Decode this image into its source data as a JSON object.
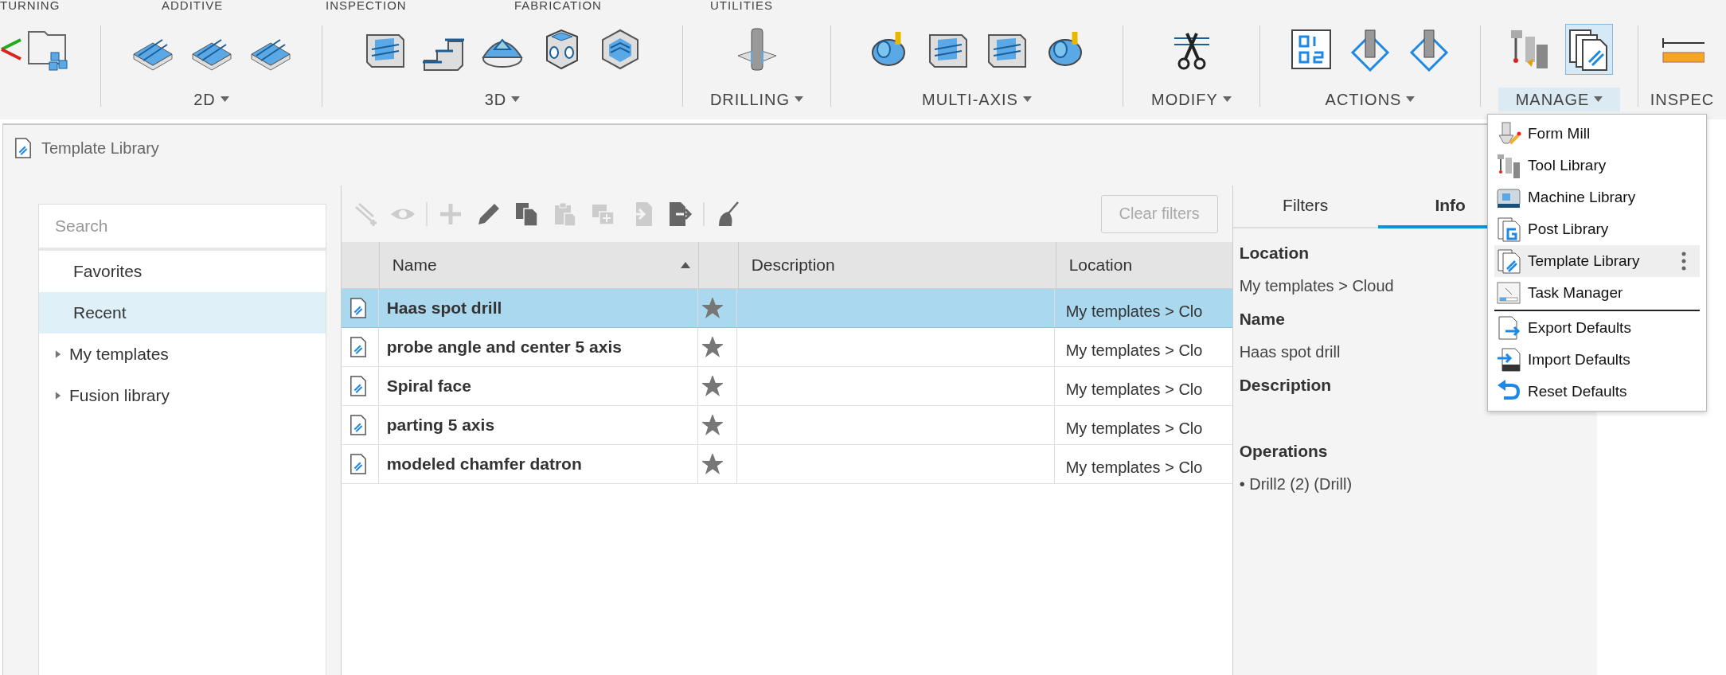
{
  "ribbon": {
    "categories": [
      "TURNING",
      "ADDITIVE",
      "INSPECTION",
      "FABRICATION",
      "UTILITIES"
    ],
    "groups": [
      {
        "label": "2D",
        "expanded": false
      },
      {
        "label": "3D",
        "expanded": false
      },
      {
        "label": "DRILLING",
        "expanded": false
      },
      {
        "label": "MULTI-AXIS",
        "expanded": false
      },
      {
        "label": "MODIFY",
        "expanded": false
      },
      {
        "label": "ACTIONS",
        "expanded": false
      },
      {
        "label": "MANAGE",
        "expanded": true
      },
      {
        "label": "INSPEC"
      }
    ]
  },
  "dialog": {
    "title": "Template Library",
    "search": {
      "placeholder": "Search"
    },
    "sidebar": {
      "items": [
        {
          "label": "Favorites",
          "selected": false
        },
        {
          "label": "Recent",
          "selected": true
        },
        {
          "label": "My templates",
          "selected": false,
          "expanded": false
        },
        {
          "label": "Fusion library",
          "selected": false,
          "expanded": false
        }
      ]
    },
    "toolbar": {
      "groups": [
        [
          {
            "kind": "new-template",
            "disabled": true
          },
          {
            "kind": "preview",
            "disabled": true
          }
        ],
        [
          {
            "kind": "add",
            "disabled": true
          },
          {
            "kind": "edit",
            "disabled": false
          },
          {
            "kind": "copy",
            "disabled": false
          },
          {
            "kind": "paste",
            "disabled": true
          },
          {
            "kind": "duplicate",
            "disabled": true
          },
          {
            "kind": "import",
            "disabled": true
          },
          {
            "kind": "export",
            "disabled": false
          }
        ],
        [
          {
            "kind": "clean",
            "disabled": false
          }
        ]
      ],
      "clear_filters": {
        "label": "Clear filters",
        "disabled": true
      }
    },
    "table": {
      "columns": [
        {
          "label": "Name",
          "sorted": true
        },
        {
          "label": "Description"
        },
        {
          "label": "Location"
        }
      ],
      "rows": [
        {
          "name": "Haas spot drill",
          "favorite": true,
          "location": "My templates > Clo",
          "selected": true
        },
        {
          "name": "probe angle and center 5 axis",
          "favorite": true,
          "location": "My templates > Clo",
          "selected": false
        },
        {
          "name": "Spiral face",
          "favorite": true,
          "location": "My templates > Clo",
          "selected": false
        },
        {
          "name": "parting 5 axis",
          "favorite": true,
          "location": "My templates > Clo",
          "selected": false
        },
        {
          "name": "modeled chamfer datron",
          "favorite": true,
          "location": "My templates > Clo",
          "selected": false
        }
      ]
    },
    "panel": {
      "tabs": [
        {
          "label": "Filters",
          "selected": false
        },
        {
          "label": "Info",
          "selected": true
        }
      ],
      "fields": [
        {
          "heading": "Location",
          "value": "My templates > Cloud"
        },
        {
          "heading": "Name",
          "value": "Haas spot drill"
        },
        {
          "heading": "Description"
        },
        {
          "heading": "Operations",
          "value": "• Drill2 (2) (Drill)"
        }
      ]
    }
  },
  "menu": {
    "sections": [
      [
        {
          "label": "Form Mill",
          "kind": "form-mill",
          "selected": false
        },
        {
          "label": "Tool Library",
          "kind": "tools",
          "selected": false
        },
        {
          "label": "Machine Library",
          "kind": "machine",
          "selected": false
        },
        {
          "label": "Post Library",
          "kind": "post",
          "selected": false
        },
        {
          "label": "Template Library",
          "kind": "template",
          "selected": true
        },
        {
          "label": "Task Manager",
          "kind": "task",
          "selected": false
        }
      ],
      [
        {
          "label": "Export Defaults",
          "kind": "export",
          "selected": false
        },
        {
          "label": "Import Defaults",
          "kind": "import",
          "selected": false
        },
        {
          "label": "Reset Defaults",
          "kind": "reset",
          "selected": false
        }
      ]
    ]
  }
}
